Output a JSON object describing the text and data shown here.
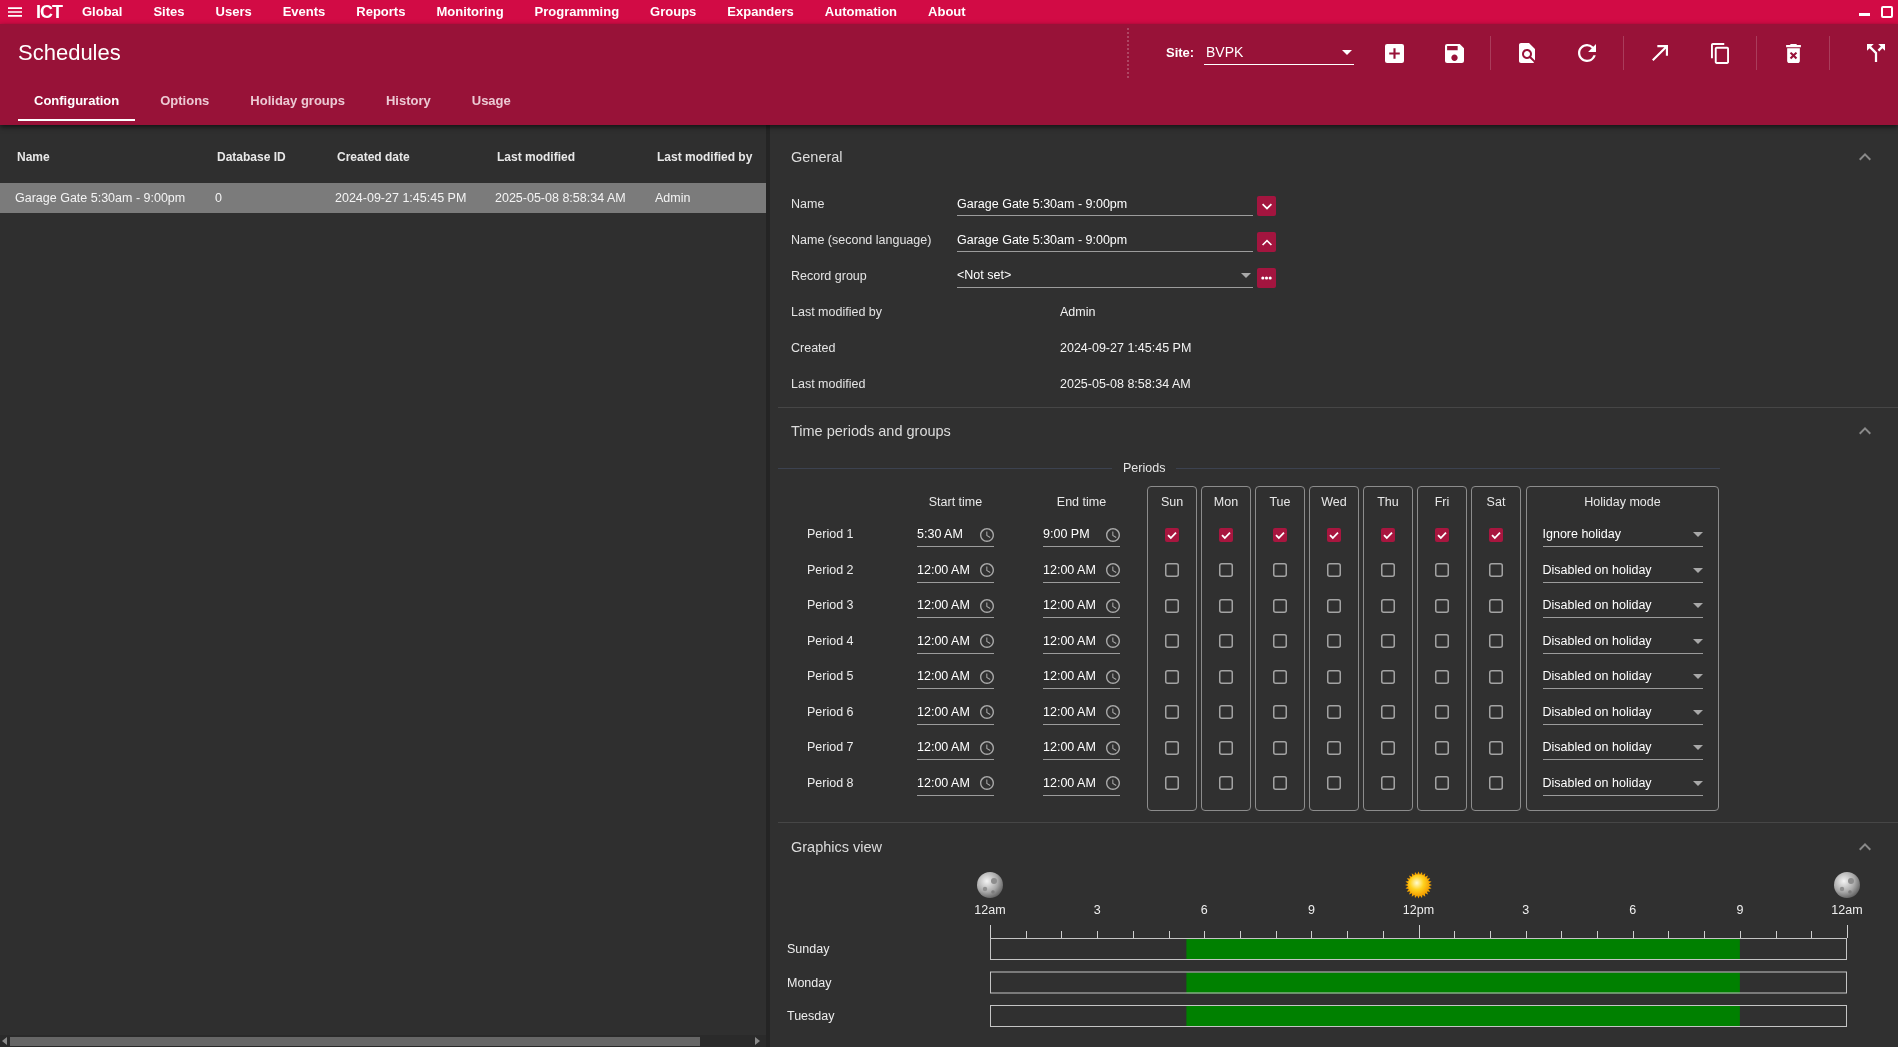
{
  "menu_bar": {
    "logo": "ICT",
    "items": [
      "Global",
      "Sites",
      "Users",
      "Events",
      "Reports",
      "Monitoring",
      "Programming",
      "Groups",
      "Expanders",
      "Automation",
      "About"
    ]
  },
  "header": {
    "title": "Schedules",
    "site": {
      "label": "Site:",
      "value": "BVPK"
    },
    "tabs": [
      {
        "label": "Configuration",
        "selected": true
      },
      {
        "label": "Options",
        "selected": false
      },
      {
        "label": "Holiday groups",
        "selected": false
      },
      {
        "label": "History",
        "selected": false
      },
      {
        "label": "Usage",
        "selected": false
      }
    ]
  },
  "list": {
    "columns": [
      "Name",
      "Database ID",
      "Created date",
      "Last modified",
      "Last modified by"
    ],
    "rows": [
      {
        "selected": true,
        "cells": [
          "Garage Gate 5:30am - 9:00pm",
          "0",
          "2024-09-27 1:45:45 PM",
          "2025-05-08 8:58:34 AM",
          "Admin"
        ]
      }
    ]
  },
  "general": {
    "title": "General",
    "expanded": true,
    "fields": [
      {
        "label": "Name",
        "kind": "text",
        "value": "Garage Gate 5:30am - 9:00pm",
        "expanded": false
      },
      {
        "label": "Name (second language)",
        "kind": "text",
        "value": "Garage Gate 5:30am - 9:00pm",
        "expanded": true
      },
      {
        "label": "Record group",
        "kind": "select",
        "value": "<Not set>"
      }
    ],
    "info": [
      {
        "label": "Last modified by",
        "value": "Admin"
      },
      {
        "label": "Created",
        "value": "2024-09-27 1:45:45 PM"
      },
      {
        "label": "Last modified",
        "value": "2025-05-08 8:58:34 AM"
      }
    ]
  },
  "time_periods": {
    "title": "Time periods and groups",
    "expanded": true,
    "legend": "Periods",
    "columns": {
      "start": "Start time",
      "end": "End time",
      "days": [
        "Sun",
        "Mon",
        "Tue",
        "Wed",
        "Thu",
        "Fri",
        "Sat"
      ],
      "holiday": "Holiday mode"
    },
    "periods": [
      {
        "label": "Period 1",
        "start": "5:30 AM",
        "end": "9:00 PM",
        "days": [
          {
            "checked": true
          },
          {
            "checked": true
          },
          {
            "checked": true
          },
          {
            "checked": true
          },
          {
            "checked": true
          },
          {
            "checked": true
          },
          {
            "checked": true
          }
        ],
        "holiday_mode": "Ignore holiday"
      },
      {
        "label": "Period 2",
        "start": "12:00 AM",
        "end": "12:00 AM",
        "days": [
          {
            "checked": false
          },
          {
            "checked": false
          },
          {
            "checked": false
          },
          {
            "checked": false
          },
          {
            "checked": false
          },
          {
            "checked": false
          },
          {
            "checked": false
          }
        ],
        "holiday_mode": "Disabled on holiday"
      },
      {
        "label": "Period 3",
        "start": "12:00 AM",
        "end": "12:00 AM",
        "days": [
          {
            "checked": false
          },
          {
            "checked": false
          },
          {
            "checked": false
          },
          {
            "checked": false
          },
          {
            "checked": false
          },
          {
            "checked": false
          },
          {
            "checked": false
          }
        ],
        "holiday_mode": "Disabled on holiday"
      },
      {
        "label": "Period 4",
        "start": "12:00 AM",
        "end": "12:00 AM",
        "days": [
          {
            "checked": false
          },
          {
            "checked": false
          },
          {
            "checked": false
          },
          {
            "checked": false
          },
          {
            "checked": false
          },
          {
            "checked": false
          },
          {
            "checked": false
          }
        ],
        "holiday_mode": "Disabled on holiday"
      },
      {
        "label": "Period 5",
        "start": "12:00 AM",
        "end": "12:00 AM",
        "days": [
          {
            "checked": false
          },
          {
            "checked": false
          },
          {
            "checked": false
          },
          {
            "checked": false
          },
          {
            "checked": false
          },
          {
            "checked": false
          },
          {
            "checked": false
          }
        ],
        "holiday_mode": "Disabled on holiday"
      },
      {
        "label": "Period 6",
        "start": "12:00 AM",
        "end": "12:00 AM",
        "days": [
          {
            "checked": false
          },
          {
            "checked": false
          },
          {
            "checked": false
          },
          {
            "checked": false
          },
          {
            "checked": false
          },
          {
            "checked": false
          },
          {
            "checked": false
          }
        ],
        "holiday_mode": "Disabled on holiday"
      },
      {
        "label": "Period 7",
        "start": "12:00 AM",
        "end": "12:00 AM",
        "days": [
          {
            "checked": false
          },
          {
            "checked": false
          },
          {
            "checked": false
          },
          {
            "checked": false
          },
          {
            "checked": false
          },
          {
            "checked": false
          },
          {
            "checked": false
          }
        ],
        "holiday_mode": "Disabled on holiday"
      },
      {
        "label": "Period 8",
        "start": "12:00 AM",
        "end": "12:00 AM",
        "days": [
          {
            "checked": false
          },
          {
            "checked": false
          },
          {
            "checked": false
          },
          {
            "checked": false
          },
          {
            "checked": false
          },
          {
            "checked": false
          },
          {
            "checked": false
          }
        ],
        "holiday_mode": "Disabled on holiday"
      }
    ]
  },
  "graphics_view": {
    "title": "Graphics view",
    "expanded": true,
    "hour_labels": [
      "12am",
      "3",
      "6",
      "9",
      "12pm",
      "3",
      "6",
      "9",
      "12am"
    ],
    "days": [
      "Sunday",
      "Monday",
      "Tuesday"
    ]
  }
}
